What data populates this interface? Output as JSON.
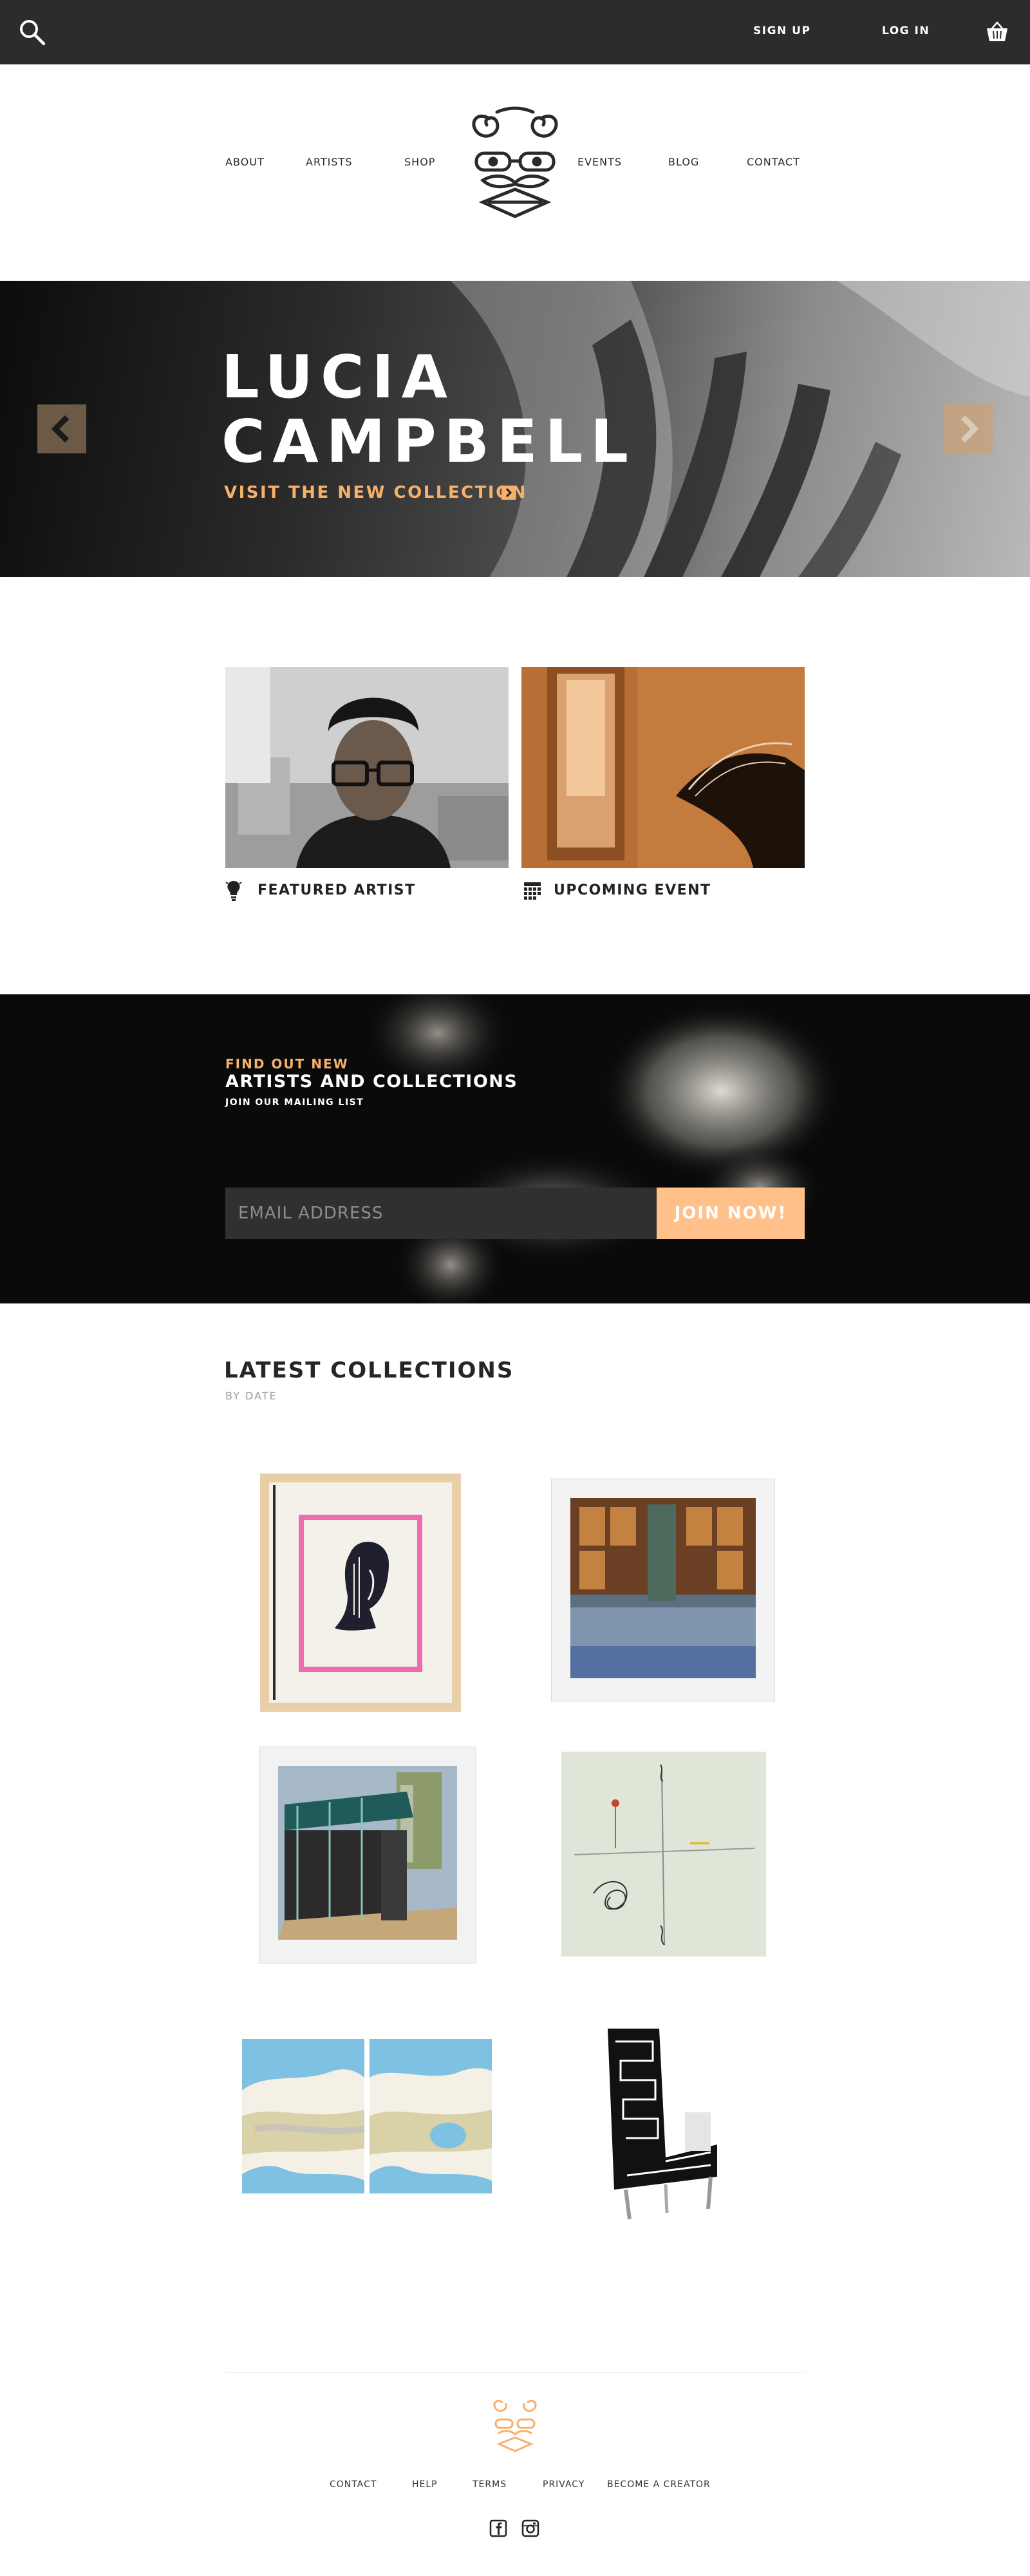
{
  "topbar": {
    "signup_label": "SIGN UP",
    "login_label": "LOG IN",
    "search_icon": "search-icon",
    "cart_icon": "basket-icon"
  },
  "nav": {
    "items": [
      "ABOUT",
      "ARTISTS",
      "SHOP",
      "EVENTS",
      "BLOG",
      "CONTACT"
    ],
    "logo": "mustache-face-logo"
  },
  "hero": {
    "title": "LUCIA\nCAMPBELL",
    "cta_label": "VISIT THE NEW COLLECTION",
    "prev_icon": "chevron-left-icon",
    "next_icon": "chevron-right-icon"
  },
  "features": [
    {
      "label": "FEATURED ARTIST",
      "icon": "lightbulb-icon"
    },
    {
      "label": "UPCOMING EVENT",
      "icon": "calendar-icon"
    }
  ],
  "mailing": {
    "eyebrow": "FIND OUT NEW",
    "heading": "ARTISTS AND COLLECTIONS",
    "sub": "JOIN OUR MAILING LIST",
    "email_placeholder": "EMAIL ADDRESS",
    "button_label": "JOIN NOW!"
  },
  "collections": {
    "title": "LATEST COLLECTIONS",
    "subtitle": "BY DATE"
  },
  "footer": {
    "links": [
      "CONTACT",
      "HELP",
      "TERMS",
      "PRIVACY",
      "BECOME A CREATOR"
    ],
    "social": [
      "facebook-icon",
      "instagram-icon"
    ]
  },
  "colors": {
    "accent": "#f6b06a",
    "button": "#ffc08a",
    "topbar": "#2c2c2c",
    "mailing_bg": "#0a0a0a"
  }
}
